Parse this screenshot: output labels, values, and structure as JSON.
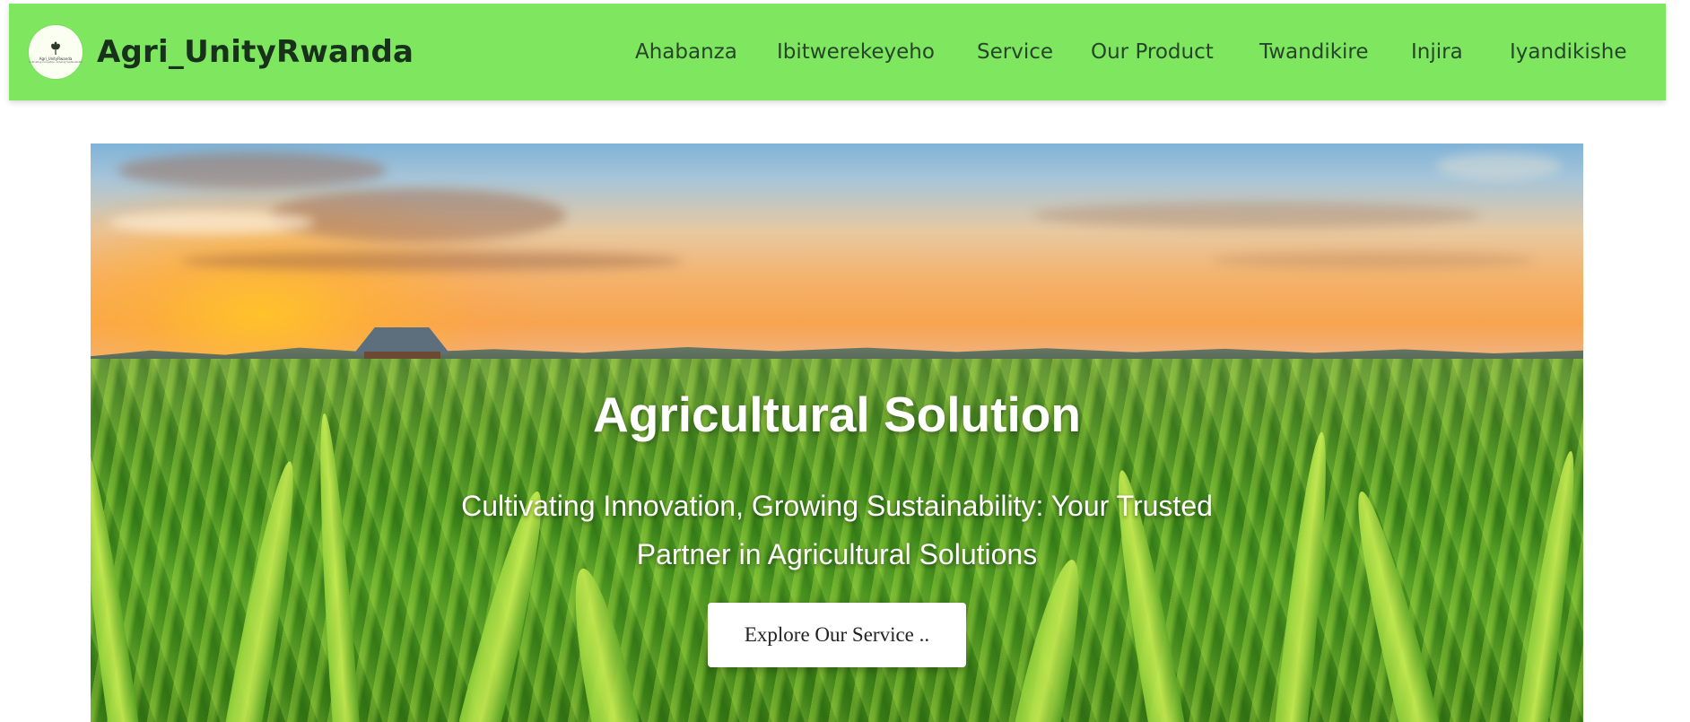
{
  "header": {
    "brand": "Agri_UnityRwanda",
    "logo": {
      "text": "Agri_UnityRwanda",
      "tagline": "Cultivating Innovation, Growing Sustainability",
      "icon": "plant-icon"
    },
    "nav": [
      {
        "label": "Ahabanza"
      },
      {
        "label": "Ibitwerekeyeho"
      },
      {
        "label": "Service"
      },
      {
        "label": "Our Product"
      },
      {
        "label": "Twandikire"
      },
      {
        "label": "Injira"
      },
      {
        "label": "Iyandikishe"
      }
    ]
  },
  "hero": {
    "title": "Agricultural Solution",
    "subtitle": "Cultivating Innovation, Growing Sustainability: Your Trusted Partner in Agricultural Solutions",
    "button_label": "Explore Our Service .."
  },
  "colors": {
    "navbar": "#7ee75f",
    "brand_text": "#17311a",
    "nav_text": "#26452a",
    "hero_text": "#ffffff",
    "button_bg": "#ffffff"
  }
}
